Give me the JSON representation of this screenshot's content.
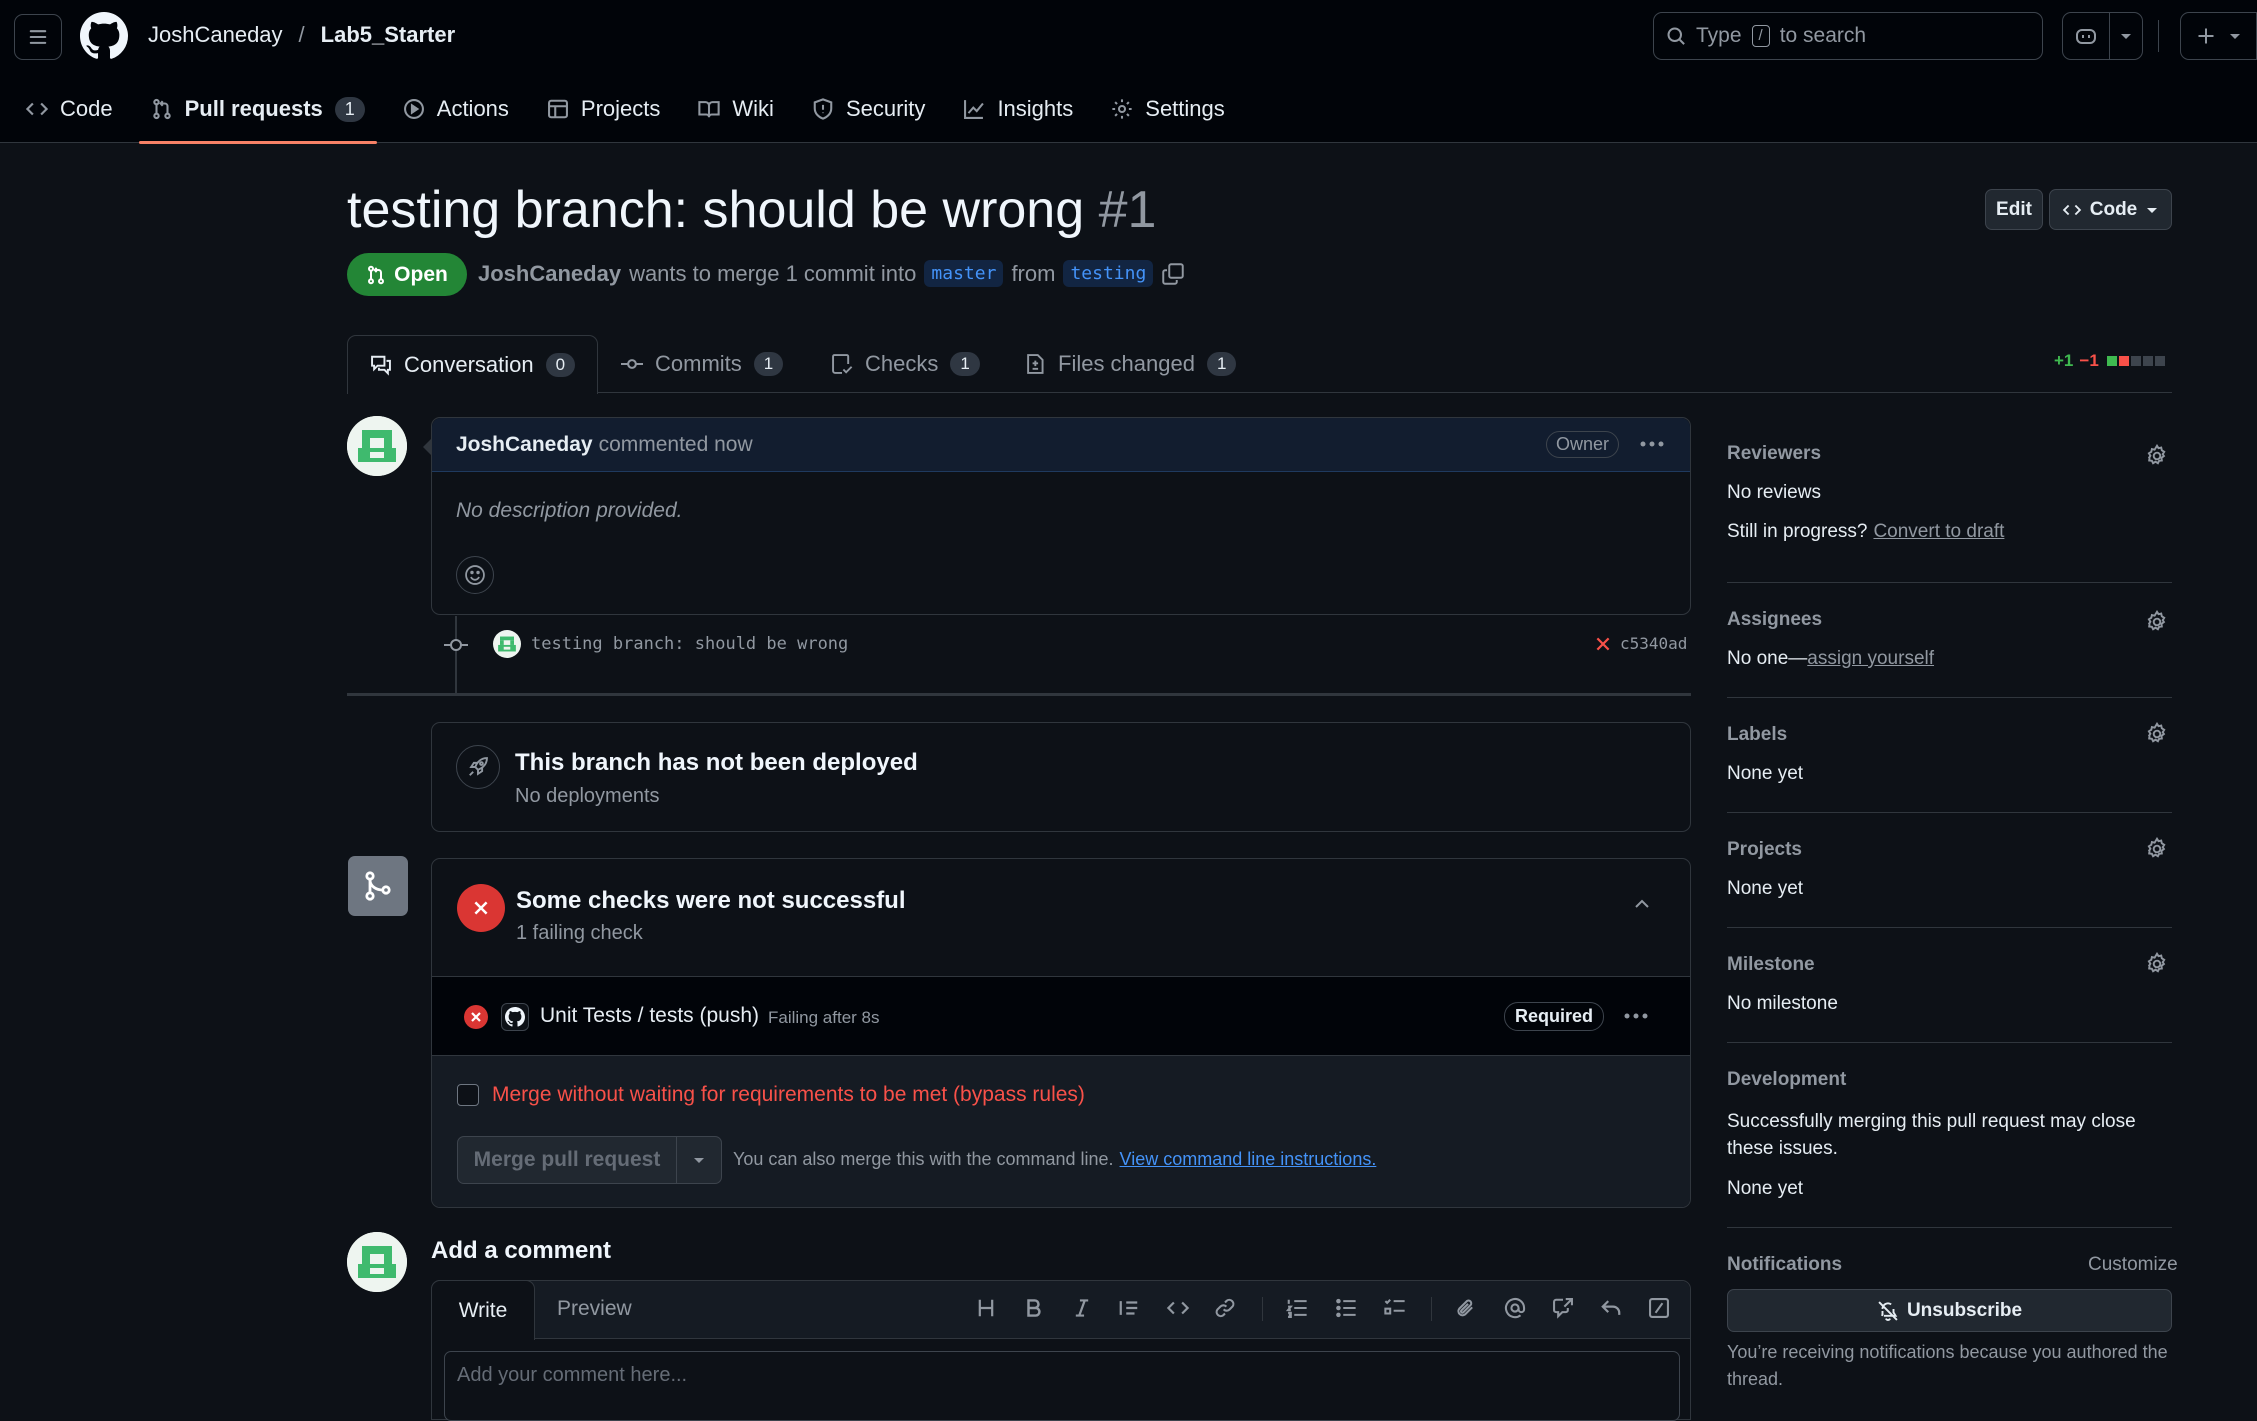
{
  "header": {
    "owner": "JoshCaneday",
    "separator": "/",
    "repo": "Lab5_Starter",
    "search_prefix": "Type",
    "search_key": "/",
    "search_suffix": "to search"
  },
  "repo_nav": [
    {
      "label": "Code",
      "icon": "code-icon"
    },
    {
      "label": "Pull requests",
      "icon": "pull-request-icon",
      "count": "1"
    },
    {
      "label": "Actions",
      "icon": "play-icon"
    },
    {
      "label": "Projects",
      "icon": "table-icon"
    },
    {
      "label": "Wiki",
      "icon": "book-icon"
    },
    {
      "label": "Security",
      "icon": "shield-icon"
    },
    {
      "label": "Insights",
      "icon": "graph-icon"
    },
    {
      "label": "Settings",
      "icon": "gear-icon"
    }
  ],
  "pr": {
    "title": "testing branch: should be wrong",
    "number": "#1",
    "state": "Open",
    "author": "JoshCaneday",
    "merge_text": "wants to merge 1 commit into",
    "base": "master",
    "from_text": "from",
    "head": "testing",
    "edit_label": "Edit",
    "code_label": "Code"
  },
  "tabs": [
    {
      "label": "Conversation",
      "count": "0"
    },
    {
      "label": "Commits",
      "count": "1"
    },
    {
      "label": "Checks",
      "count": "1"
    },
    {
      "label": "Files changed",
      "count": "1"
    }
  ],
  "diffstat": {
    "added": "+1",
    "removed": "−1"
  },
  "comment": {
    "author": "JoshCaneday",
    "action": "commented now",
    "badge": "Owner",
    "body": "No description provided."
  },
  "commit": {
    "message": "testing branch: should be wrong",
    "sha": "c5340ad"
  },
  "deploy": {
    "title": "This branch has not been deployed",
    "subtitle": "No deployments"
  },
  "checks": {
    "title": "Some checks were not successful",
    "subtitle": "1 failing check",
    "item_name": "Unit Tests / tests (push)",
    "item_status": "Failing after 8s",
    "required": "Required"
  },
  "merge": {
    "bypass_label": "Merge without waiting for requirements to be met (bypass rules)",
    "button": "Merge pull request",
    "cli_text": "You can also merge this with the command line.",
    "cli_link": "View command line instructions."
  },
  "add_comment": {
    "heading": "Add a comment",
    "write_tab": "Write",
    "preview_tab": "Preview",
    "placeholder": "Add your comment here..."
  },
  "sidebar": {
    "reviewers": {
      "title": "Reviewers",
      "value": "No reviews",
      "draft_prefix": "Still in progress?",
      "draft_link": "Convert to draft"
    },
    "assignees": {
      "title": "Assignees",
      "prefix": "No one—",
      "link": "assign yourself"
    },
    "labels": {
      "title": "Labels",
      "value": "None yet"
    },
    "projects": {
      "title": "Projects",
      "value": "None yet"
    },
    "milestone": {
      "title": "Milestone",
      "value": "No milestone"
    },
    "development": {
      "title": "Development",
      "text": "Successfully merging this pull request may close these issues.",
      "value": "None yet"
    },
    "notifications": {
      "title": "Notifications",
      "customize": "Customize",
      "button": "Unsubscribe",
      "reason": "You’re receiving notifications because you authored the thread."
    }
  },
  "colors": {
    "accent": "#f78166",
    "open": "#238636",
    "danger": "#da3633",
    "link": "#4493f8"
  }
}
